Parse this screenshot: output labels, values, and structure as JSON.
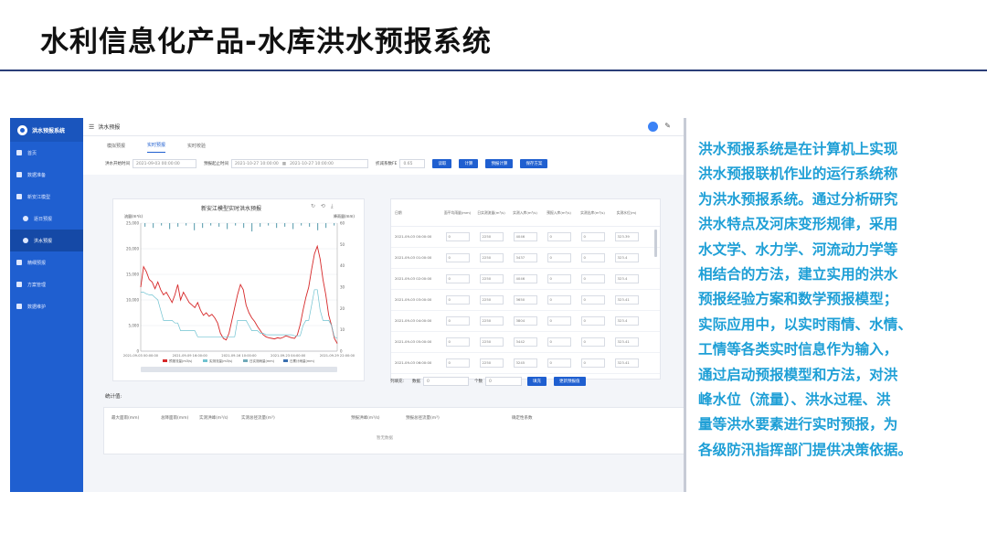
{
  "slide": {
    "title": "水利信息化产品-水库洪水预报系统"
  },
  "app": {
    "brand": "洪水预报系统",
    "sidebar": [
      {
        "label": "首页",
        "level": 1,
        "active": false
      },
      {
        "label": "数据准备",
        "level": 1,
        "active": false
      },
      {
        "label": "新安江模型",
        "level": 1,
        "active": false
      },
      {
        "label": "逐日预报",
        "level": 2,
        "active": false
      },
      {
        "label": "洪水预报",
        "level": 2,
        "active": true
      },
      {
        "label": "精细预报",
        "level": 1,
        "active": false
      },
      {
        "label": "方案管理",
        "level": 1,
        "active": false
      },
      {
        "label": "数据维护",
        "level": 1,
        "active": false
      }
    ],
    "topbar": {
      "page": "洪水预报"
    },
    "tabs": [
      "模拟预报",
      "实时预报",
      "实时校验"
    ],
    "active_tab": 1,
    "filters": {
      "start_label": "洪水开始时间",
      "start_value": "2021-09-03 00:00:00",
      "period_label": "预报起止时间",
      "period_from": "2021-10-27 10:00:00",
      "period_to": "2021-10-27 10:00:00",
      "coef_label": "折减系数FE",
      "coef_value": "0.65",
      "buttons": [
        "读取",
        "计算",
        "预报计算",
        "保存方案"
      ]
    },
    "chart": {
      "title": "新安江模型实时洪水预报",
      "y_left_label": "流量(m³/s)",
      "y_right_label": "降雨量(mm)",
      "tools": "↻ ⟲ ⤓",
      "legend": [
        "预报流量(m3/s)",
        "实测流量(m3/s)",
        "日实测雨量(mm)",
        "日累计雨量(mm)"
      ]
    },
    "table": {
      "headers": [
        "日期",
        "面平均雨量(mm)",
        "日实测流量(m³/s)",
        "实测入库(m³/s)",
        "预报入库(m³/s)",
        "实测出库(m³/s)",
        "实测水位(m)"
      ],
      "rows": [
        [
          "2021-09-03 00:00:00",
          "0",
          "2250",
          "4046",
          "0",
          "0",
          "323.39"
        ],
        [
          "2021-09-03 01:00:00",
          "0",
          "2250",
          "3437",
          "0",
          "0",
          "323.4"
        ],
        [
          "2021-09-03 02:00:00",
          "0",
          "2250",
          "4046",
          "0",
          "0",
          "323.4"
        ],
        [
          "2021-09-03 03:00:00",
          "0",
          "2250",
          "3650",
          "0",
          "0",
          "323.41"
        ],
        [
          "2021-09-03 04:00:00",
          "0",
          "2250",
          "3804",
          "0",
          "0",
          "323.4"
        ],
        [
          "2021-09-03 05:00:00",
          "0",
          "2250",
          "3442",
          "0",
          "0",
          "323.41"
        ],
        [
          "2021-09-03 06:00:00",
          "0",
          "2250",
          "3245",
          "0",
          "0",
          "323.41"
        ]
      ]
    },
    "bottom": {
      "label_a": "列填充:",
      "label_b": "数据",
      "value_b": "0",
      "label_c": "个数",
      "value_c": "0",
      "btn_fill": "填充",
      "btn_update": "更新预报值"
    },
    "stats": {
      "title": "统计值:",
      "cols": [
        "最大面雨(mm)",
        "总降面雨(mm)",
        "实测洪峰(m³/s)",
        "实测总径流量(m³)",
        "预报洪峰(m³/s)",
        "预报总径流量(m³)",
        "确定性系数"
      ],
      "empty": "暂无数据"
    }
  },
  "chart_data": {
    "type": "line",
    "title": "新安江模型实时洪水预报",
    "ylabel": "流量(m³/s)",
    "y2label": "降雨量(mm)",
    "ylim": [
      0,
      25000
    ],
    "y2lim": [
      0,
      60
    ],
    "yticks": [
      0,
      5000,
      10000,
      15000,
      20000,
      25000
    ],
    "y2ticks": [
      0,
      10,
      20,
      30,
      40,
      50,
      60
    ],
    "xticks": [
      "2021-09-03 00:00:00",
      "2021-09-09 16:00:00",
      "2021-09-16 10:00:00",
      "2021-09-23 04:00:00",
      "2021-09-29 22:00:00"
    ],
    "series": [
      {
        "name": "预报流量(m3/s)",
        "color": "#d62728",
        "values": [
          12500,
          16500,
          15500,
          14000,
          13500,
          12200,
          13500,
          12000,
          11000,
          11500,
          10500,
          9500,
          11000,
          13000,
          10000,
          11500,
          10500,
          9500,
          9000,
          8500,
          9500,
          8000,
          7000,
          7500,
          6800,
          7200,
          6500,
          5500,
          3500,
          2500,
          2200,
          3500,
          6000,
          8500,
          11000,
          13000,
          12000,
          9000,
          7500,
          6500,
          5800,
          4800,
          4000,
          3200,
          2800,
          2600,
          2500,
          2400,
          2600,
          2500,
          2700,
          3000,
          2800,
          2600,
          2500,
          3200,
          5200,
          8000,
          10500,
          12500,
          16000,
          19000,
          20500,
          18000,
          14000,
          11000,
          7000,
          5000,
          2500,
          1500
        ]
      },
      {
        "name": "实测流量(m3/s)",
        "color": "#6fc2d0",
        "values": [
          11500,
          11500,
          11200,
          11000,
          11000,
          10500,
          10000,
          8000,
          6000,
          6000,
          6000,
          6000,
          5500,
          5500,
          4000,
          4000,
          4000,
          4000,
          4000,
          4000,
          2800,
          2800,
          2800,
          2800,
          2800,
          2800,
          2800,
          2800,
          2800,
          2800,
          2800,
          2800,
          2800,
          2800,
          6000,
          6000,
          6000,
          6000,
          5000,
          4000,
          4000,
          4000,
          3500,
          3500,
          3200,
          3200,
          3200,
          3200,
          3200,
          3200,
          3200,
          3200,
          3200,
          3200,
          3000,
          3000,
          3000,
          5000,
          6000,
          6000,
          9000,
          12000,
          12000,
          8000,
          6000,
          6000,
          6000,
          5000,
          2800,
          2500
        ]
      }
    ],
    "legend_position": "bottom",
    "grid": true
  }
}
